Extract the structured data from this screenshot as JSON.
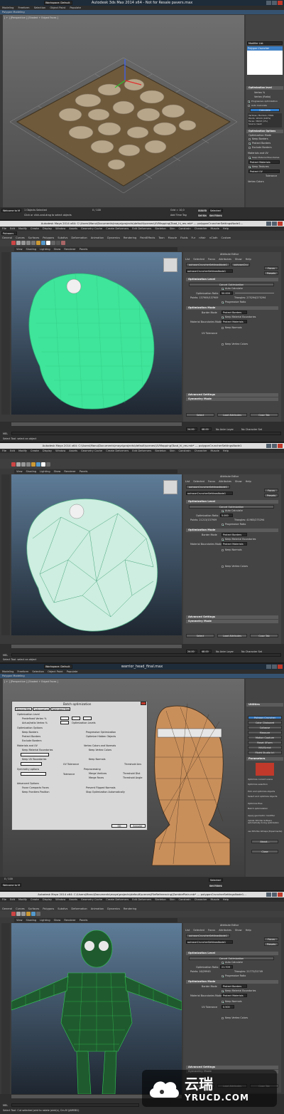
{
  "shot1": {
    "title": "Autodesk 3ds Max  2014 x64  -  Not for Resale   pavers.max",
    "workspace": "Workspace: Default",
    "ribbon_tabs": [
      "Modeling",
      "Freeform",
      "Selection",
      "Object Paint",
      "Populate"
    ],
    "ribbon_sub": "Polygon Modeling",
    "viewport_label": "[ + ] [Perspective ] [Shaded + Edged Faces ]",
    "modifier_list": "Modifier List",
    "modifier_item": "Polygon Cruncher",
    "rollout_opt_level": "Optimization level",
    "vertex_pct": "Vertex %",
    "vertex_ratio": "Vertex (Ratio)",
    "progressive": "Progressive optimization",
    "auto_calc": "Auto Calculate",
    "calculate": "Calculate",
    "info_lines": [
      "Vertices / Borders / Mats",
      "Points: 18124 (100%)",
      "Faces: 36013 (1%)",
      "Source mesh"
    ],
    "rollout_opt_options": "Optimization Options",
    "opt_mode": "Optimization Mode",
    "opt_checks": [
      "Keep Borders",
      "Protect Borders",
      "Exclude Borders"
    ],
    "materials_uv": "Materials and UV",
    "keep_mat": "Keep Material Boundaries",
    "protect_mat": "Protect Materials",
    "keep_tex": "Keep Textures",
    "protect_uv": "Protect UV",
    "tolerance": "Tolerance",
    "vertex_colors": "Vertex Colors",
    "objects_selected": "1 Objects Selected",
    "status_hint": "Click or click-and-drag to select objects",
    "welcome": "Welcome to M",
    "grid": "Grid = 10,0",
    "auto_key": "Auto Key",
    "selected": "Selected",
    "set_key": "Set Key",
    "key_filters": "Key Filters...",
    "time": "0 / 100",
    "add_time_tag": "Add Time Tag"
  },
  "shot2": {
    "title": "Autodesk Maya 2014 x64: C:\\Users\\Manu\\Documents\\maya\\projects\\default\\scenes\\UVMapping\\Toad_hi_res.mb*   ---   polygonCruncherSettingsNode1...",
    "mode": "Polygons",
    "menus": [
      "File",
      "Edit",
      "Modify",
      "Create",
      "Display",
      "Window",
      "Assets",
      "Geometry Cache",
      "Create Deformers",
      "Edit Deformers",
      "Skeleton",
      "Skin",
      "Constrain",
      "Character",
      "Muscle",
      "Help"
    ],
    "shelf_tabs": [
      "General",
      "Curves",
      "Surfaces",
      "Polygons",
      "Subdivs",
      "Deformation",
      "Animation",
      "Dynamics",
      "Rendering",
      "PaintEffects",
      "Toon",
      "Muscle",
      "Fluids",
      "Fur",
      "nHair",
      "nCloth",
      "Custom"
    ],
    "view_menus": [
      "View",
      "Shading",
      "Lighting",
      "Show",
      "Renderer",
      "Panels"
    ],
    "ae_title": "Attribute Editor",
    "ae_menus": [
      "List",
      "Selected",
      "Focus",
      "Attributes",
      "Show",
      "Help"
    ],
    "node_tabs": [
      "polygonCruncherSettingsNode1",
      "polygonCru"
    ],
    "node_field": "polygonCruncherSettingsNode1",
    "focus": "Focus",
    "presets": "Presets",
    "sect_opt_level": "Optimization Level",
    "cancel_opt": "Cancel Optimization",
    "auto_calc": "Auto Calculate",
    "opt_ratio_label": "Optimization Ratio",
    "opt_ratio": "50.000",
    "points": "Points: 137909/137909",
    "triangles": "Triangles: 275294/275294",
    "progressive": "Progressive Ratio",
    "sect_opt_mode": "Optimization Mode",
    "border_mode_label": "Border Mode",
    "border_mode": "Protect Borders",
    "keep_mat": "Keep Material Boundaries",
    "mat_mode_label": "Material Boundaries Mode",
    "mat_mode": "Protect Materials",
    "keep_normals": "Keep Normals",
    "uv_tolerance": "UV Tolerance",
    "keep_vc": "Keep Vertex Colors",
    "sect_adv": "Advanced Settings",
    "sect_sym": "Symmetry Mode",
    "btn_select": "Select",
    "btn_load": "Load Attributes",
    "btn_copy": "Copy Tab",
    "range_start": "24.00",
    "range_end": "48.00",
    "anim_layer": "No Anim Layer",
    "char_set": "No Character Set",
    "mel": "MEL",
    "help_line": "Select Tool: select an object"
  },
  "shot3": {
    "title": "Autodesk Maya 2014 x64: C:\\Users\\Manu\\Documents\\maya\\projects\\default\\scenes\\UVMapping\\Toad_hi_res.mb*   ---   polygonCruncherSettingsNode1",
    "opt_ratio": "5.000",
    "points": "Points: 21213/137909",
    "triangles": "Triangles: 41983/275294"
  },
  "shot4": {
    "title": "warrior_head_final.max",
    "dialog_title": "Batch optimization",
    "dialog_tabs": [
      "Source files",
      "Optimization",
      "Optimized files"
    ],
    "opt_level": "Optimization Level",
    "predef": "Predefined Vertex %",
    "actual": "Actual/ratio Vertex %",
    "opt_levels": "Optimization Levels",
    "opt_options": "Optimization Options",
    "keep_borders": "Keep Borders",
    "protect_borders": "Protect Borders",
    "exclude_borders": "Exclude Borders",
    "progressive": "Progressive Optimization",
    "optimize_hidden": "Optimize Hidden Objects",
    "materials_uv": "Materials and UV",
    "keep_mat": "Keep Material Boundaries",
    "protect_materials": "Protect Materials",
    "keep_uv": "Keep UV Boundaries",
    "protect_uv": "Protect UV",
    "uv_tol": "UV Tolerance",
    "symmetry": "Symmetry options",
    "no_symmetry": "No Symmetry",
    "tolerance": "Tolerance",
    "vc_normals": "Vertex Colors and Normals",
    "keep_vc": "Keep Vertex Colors",
    "keep_normals": "Keep Normals",
    "threshold": "Threshold Ans",
    "preprocessing": "Preprocessing",
    "merge_vertices": "Merge Vertices",
    "merge_faces": "Merge Faces",
    "threshold_dist": "Threshold Dist",
    "threshold_angle": "Threshold Angle",
    "advanced": "Advanced Options",
    "favor_compact": "Favor Compacts Faces",
    "keep_frontiers": "Keep Frontiers Position",
    "prevent_flipped": "Prevent Flipped Normals",
    "stop_auto": "Stop Optimization Automatically",
    "ok": "OK",
    "cancel": "Annuler",
    "utilities": "Utilities",
    "util_buttons": [
      "Polygon Cruncher",
      "Color Clipboard",
      "Collapse",
      "Measure",
      "Motion Capture",
      "Reset XForm",
      "MAXScript",
      "Flight Studio (c)"
    ],
    "parameters": "Parameters",
    "optimize_scene": "Optimize current scene",
    "optimize_sel": "Optimize selection",
    "pick_objects": "Pick and optimize objects",
    "select_objects": "Select and optimize objects",
    "options": "Optimize files",
    "batch": "Batch optimization",
    "apply_gen": "Apply geometric modifier",
    "update": "Update 3DS Max Software automatically during optimization",
    "use_3ds": "use 3DS Max bitmaps (Experimental)",
    "about": "About...",
    "close": "Close",
    "time": "0 / 100",
    "welcome": "Welcome to M",
    "selected": "Selected",
    "key_filters": "Key Filters..."
  },
  "shot5": {
    "title": "Autodesk Maya 2014 x64: C:\\Users\\Manu\\Documents\\maya\\projects\\default\\scenes\\FileReferencing\\ZombiePlain.mb*   ---   polygonCruncherSettingsNode1...",
    "opt_ratio": "21.709",
    "points": "Points: 16/29945",
    "triangles": "Triangles: 21772/31749",
    "uv_tol_val": "0.500",
    "help_line": "Select Tool: Cut selected joint to rotate joint(s), Cm-M (JAMBB1)"
  },
  "watermark": {
    "cn": "云瑞",
    "en": "YRUCD.COM"
  },
  "colors": {
    "toad_green": "#3fe59a",
    "toad_light": "#cdeee0",
    "zombie_green": "#33cc55",
    "skin": "#c98f5b",
    "pavers": "#b8a68a",
    "maya_blue": "#3e5a7a",
    "dialog_bg": "#d8d8d8",
    "brand_red": "#c0392b",
    "cruncher_blue": "#3c7ec4"
  }
}
